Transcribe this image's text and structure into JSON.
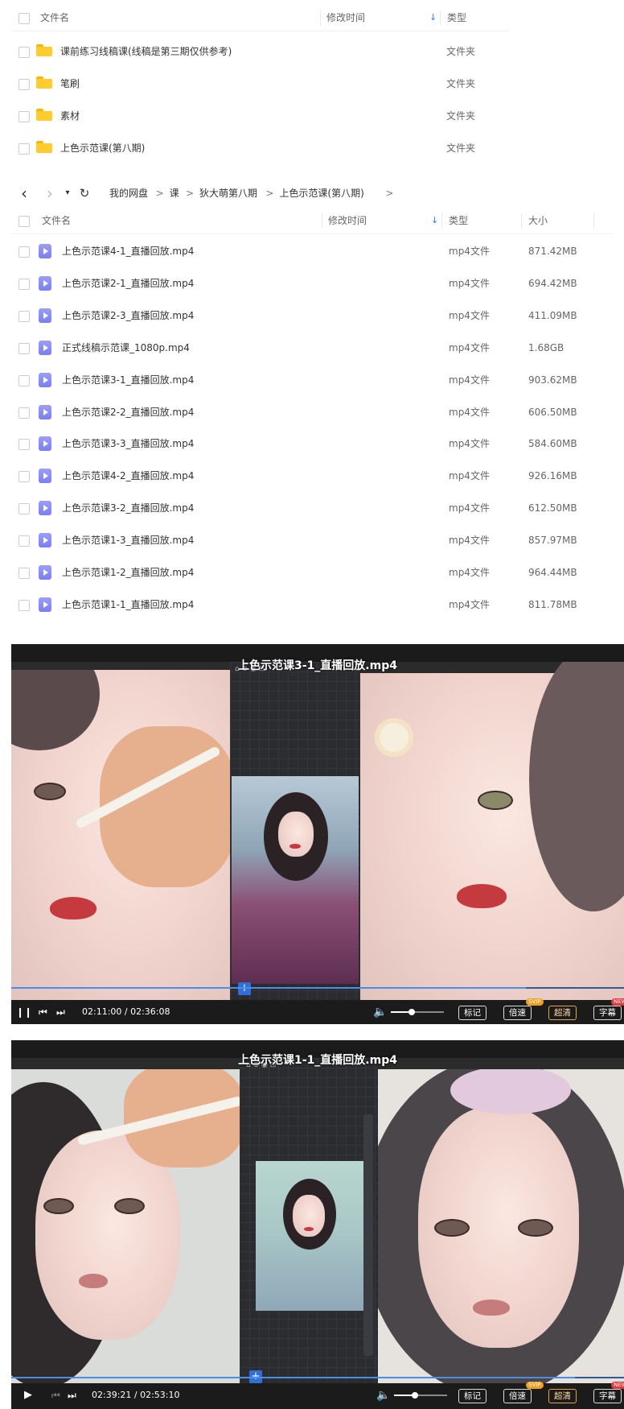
{
  "panel1": {
    "header": {
      "name": "文件名",
      "modified": "修改时间",
      "type": "类型"
    },
    "rows": [
      {
        "name": "课前练习线稿课(线稿是第三期仅供参考)",
        "type": "文件夹",
        "icon": "folder-icon"
      },
      {
        "name": "笔刷",
        "type": "文件夹",
        "icon": "folder-icon"
      },
      {
        "name": "素材",
        "type": "文件夹",
        "icon": "folder-icon"
      },
      {
        "name": "上色示范课(第八期)",
        "type": "文件夹",
        "icon": "folder-icon"
      }
    ]
  },
  "nav": {
    "back": "‹",
    "forward": "›",
    "dropdown": "▾",
    "refresh": "↻",
    "breadcrumbs": [
      "我的网盘",
      "课",
      "狄大萌第八期",
      "上色示范课(第八期)"
    ],
    "separator": ">"
  },
  "panel2": {
    "header": {
      "name": "文件名",
      "modified": "修改时间",
      "type": "类型",
      "size": "大小"
    },
    "rows": [
      {
        "name": "上色示范课4-1_直播回放.mp4",
        "type": "mp4文件",
        "size": "871.42MB"
      },
      {
        "name": "上色示范课2-1_直播回放.mp4",
        "type": "mp4文件",
        "size": "694.42MB"
      },
      {
        "name": "上色示范课2-3_直播回放.mp4",
        "type": "mp4文件",
        "size": "411.09MB"
      },
      {
        "name": "正式线稿示范课_1080p.mp4",
        "type": "mp4文件",
        "size": "1.68GB"
      },
      {
        "name": "上色示范课3-1_直播回放.mp4",
        "type": "mp4文件",
        "size": "903.62MB"
      },
      {
        "name": "上色示范课2-2_直播回放.mp4",
        "type": "mp4文件",
        "size": "606.50MB"
      },
      {
        "name": "上色示范课3-3_直播回放.mp4",
        "type": "mp4文件",
        "size": "584.60MB"
      },
      {
        "name": "上色示范课4-2_直播回放.mp4",
        "type": "mp4文件",
        "size": "926.16MB"
      },
      {
        "name": "上色示范课3-2_直播回放.mp4",
        "type": "mp4文件",
        "size": "612.50MB"
      },
      {
        "name": "上色示范课1-3_直播回放.mp4",
        "type": "mp4文件",
        "size": "857.97MB"
      },
      {
        "name": "上色示范课1-2_直播回放.mp4",
        "type": "mp4文件",
        "size": "964.44MB"
      },
      {
        "name": "上色示范课1-1_直播回放.mp4",
        "type": "mp4文件",
        "size": "811.78MB"
      }
    ]
  },
  "players": [
    {
      "title": "上色示范课3-1_直播回放.mp4",
      "time": "02:11:00 / 02:36:08",
      "progress": 0.84,
      "volume": 0.4,
      "buttons": {
        "mark": "标记",
        "speed": "倍速",
        "quality": "超清",
        "subtitle": "字幕"
      },
      "badges": {
        "svip": "SVIP",
        "new": "NEW"
      }
    },
    {
      "title": "上色示范课1-1_直播回放.mp4",
      "time": "02:39:21 / 02:53:10",
      "progress": 0.92,
      "volume": 0.4,
      "buttons": {
        "mark": "标记",
        "speed": "倍速",
        "quality": "超清",
        "subtitle": "字幕"
      },
      "badges": {
        "svip": "SVIP",
        "new": "NEW"
      }
    }
  ],
  "colors": {
    "accent": "#2f7ff5",
    "folder": "#ffcb2e",
    "video_icon": "#8b8ef5",
    "player_bg": "#1b1b1b"
  }
}
